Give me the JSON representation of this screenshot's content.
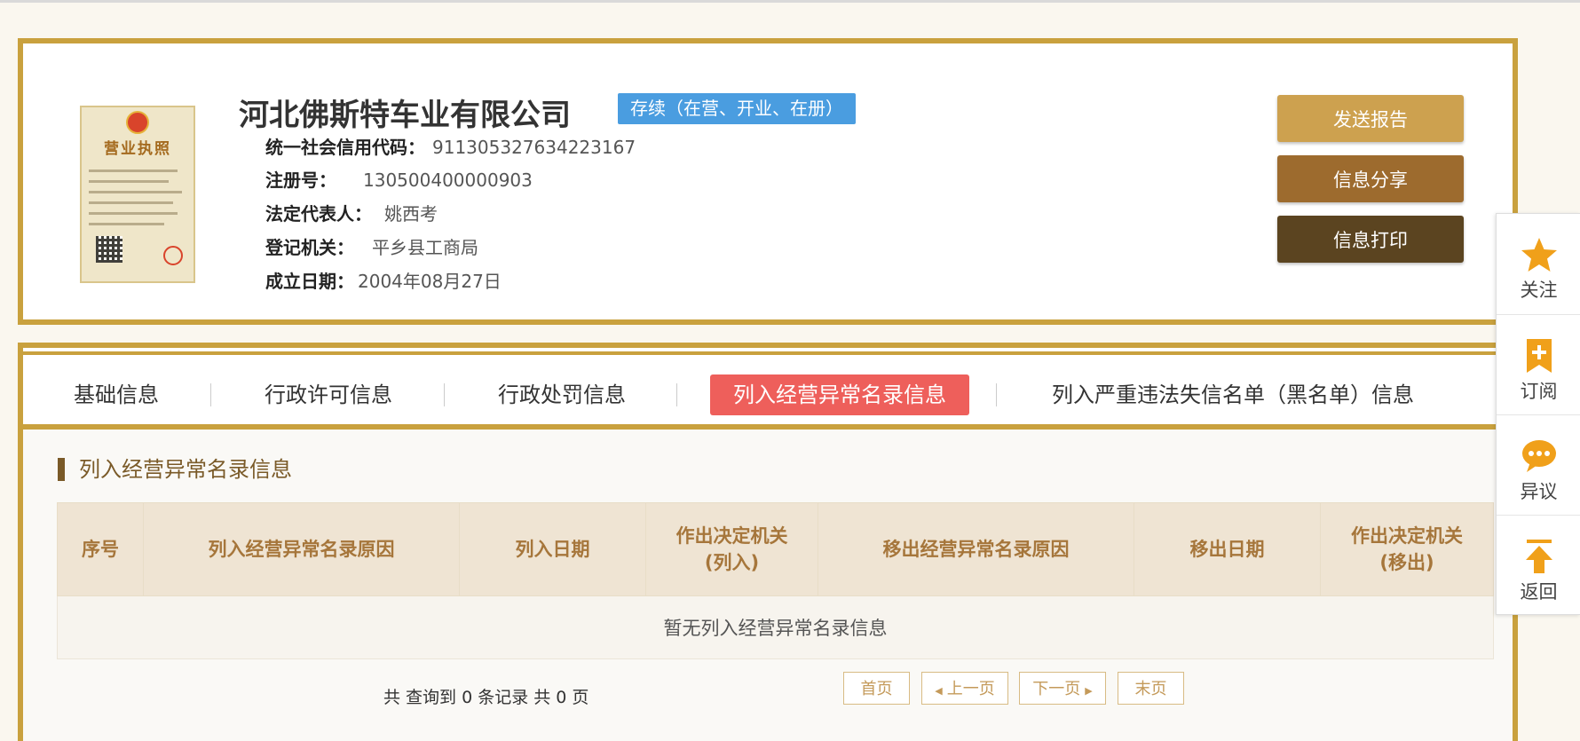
{
  "company": {
    "name": "河北佛斯特车业有限公司",
    "status": "存续（在营、开业、在册）",
    "license_title": "营业执照"
  },
  "info": [
    {
      "label": "统一社会信用代码：",
      "value": "911305327634223167"
    },
    {
      "label": "注册号：",
      "value": "130500400000903"
    },
    {
      "label": "法定代表人：",
      "value": "姚西考"
    },
    {
      "label": "登记机关：",
      "value": "平乡县工商局"
    },
    {
      "label": "成立日期：",
      "value": "2004年08月27日"
    }
  ],
  "actions": {
    "report": "发送报告",
    "share": "信息分享",
    "print": "信息打印"
  },
  "tabs": [
    {
      "label": "基础信息"
    },
    {
      "label": "行政许可信息"
    },
    {
      "label": "行政处罚信息"
    },
    {
      "label": "列入经营异常名录信息",
      "active": true
    },
    {
      "label": "列入严重违法失信名单（黑名单）信息"
    }
  ],
  "section": {
    "title": "列入经营异常名录信息",
    "columns": [
      "序号",
      "列入经营异常名录原因",
      "列入日期",
      "作出决定机关\n(列入)",
      "移出经营异常名录原因",
      "移出日期",
      "作出决定机关\n(移出)"
    ],
    "empty_message": "暂无列入经营异常名录信息"
  },
  "pagination": {
    "summary": "共 查询到 0 条记录 共 0 页",
    "first": "首页",
    "prev": "上一页",
    "next": "下一页",
    "last": "末页"
  },
  "float_bar": {
    "follow": "关注",
    "subscribe": "订阅",
    "objection": "异议",
    "back": "返回"
  },
  "colors": {
    "border_gold": "#c9a13e",
    "badge_blue": "#4a9de0",
    "active_tab": "#ee5f5b",
    "icon_orange": "#f0a01a"
  }
}
